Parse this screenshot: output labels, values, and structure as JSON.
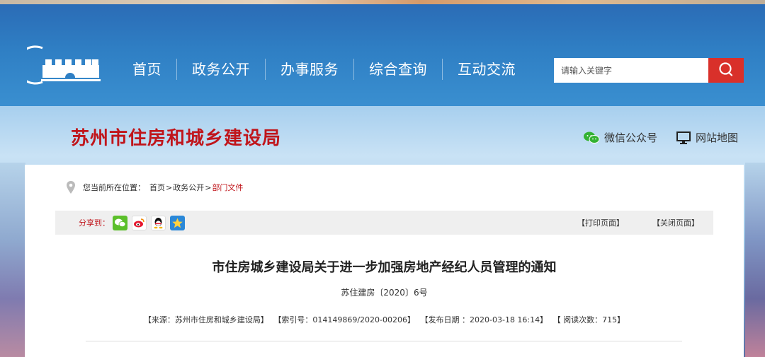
{
  "nav": {
    "items": [
      {
        "label": "首页"
      },
      {
        "label": "政务公开"
      },
      {
        "label": "办事服务"
      },
      {
        "label": "综合查询"
      },
      {
        "label": "互动交流"
      }
    ]
  },
  "search": {
    "placeholder": "请输入关键字",
    "button_icon": "search-icon"
  },
  "site": {
    "name": "苏州市住房和城乡建设局",
    "wechat_label": "微信公众号",
    "sitemap_label": "网站地图"
  },
  "breadcrumb": {
    "prefix": "您当前所在位置：",
    "home": "首页",
    "sep1": ">",
    "section": "政务公开",
    "sep2": ">",
    "current": "部门文件"
  },
  "share": {
    "label": "分享到：",
    "icons": [
      "wechat-icon",
      "weibo-icon",
      "qq-icon",
      "qzone-icon"
    ],
    "print_label": "【打印页面】",
    "close_label": "【关闭页面】"
  },
  "document": {
    "title": "市住房城乡建设局关于进一步加强房地产经纪人员管理的通知",
    "number": "苏住建房〔2020〕6号",
    "source": "【来源：苏州市住房和城乡建设局】",
    "index": "【索引号：014149869/2020-00206】",
    "date": "【发布日期 ：2020-03-18 16:14】",
    "views": "【 阅读次数：715】"
  },
  "colors": {
    "header_blue": "#2f7fc4",
    "brand_red": "#c0151b",
    "search_button": "#d9302a"
  }
}
